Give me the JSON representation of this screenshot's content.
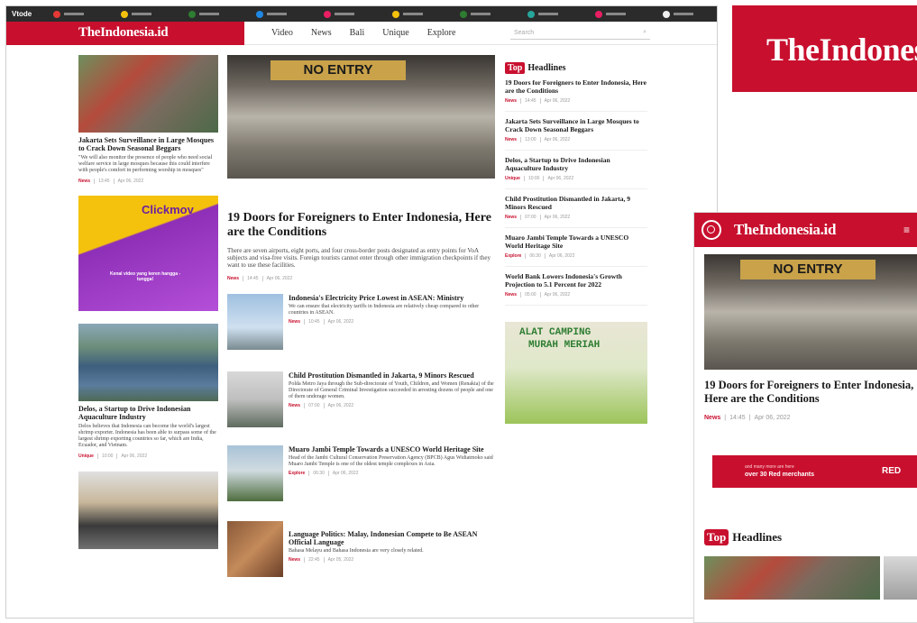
{
  "desktop": {
    "topbar": {
      "brand": "Vtode",
      "sites": [
        {
          "color": "#e53935"
        },
        {
          "color": "#f4c20d"
        },
        {
          "color": "#2e7d32"
        },
        {
          "color": "#1e88e5"
        },
        {
          "color": "#e91e63"
        },
        {
          "color": "#f4c20d"
        },
        {
          "color": "#2e7d32"
        },
        {
          "color": "#26a69a"
        },
        {
          "color": "#e91e63"
        },
        {
          "color": "#eeeeee"
        }
      ]
    },
    "logo": "TheIndonesia.id",
    "nav": [
      "Video",
      "News",
      "Bali",
      "Unique",
      "Explore"
    ],
    "search_placeholder": "Search",
    "left": [
      {
        "title": "Jakarta Sets Surveillance in Large Mosques to Crack Down Seasonal Beggars",
        "excerpt": "\"We will also monitor the presence of people who need social welfare service in large mosques because this could interfere with people's comfort in performing worship in mosques\"",
        "category": "News",
        "time": "13:45",
        "date": "Apr 06, 2022"
      },
      {
        "title": "Delos, a Startup to Drive Indonesian Aquaculture Industry",
        "excerpt": "Delos believes that Indonesia can become the world's largest shrimp exporter. Indonesia has been able to surpass some of the largest shrimp exporting countries so far, which are India, Ecuador, and Vietnam.",
        "category": "Unique",
        "time": "10:00",
        "date": "Apr 06, 2022"
      }
    ],
    "ad_clickmov": {
      "brand": "Clickmov",
      "text": "Kenal video yang keren hangga - tungga!"
    },
    "main": {
      "sign": "NO ENTRY",
      "title": "19 Doors for Foreigners to Enter Indonesia, Here are the Conditions",
      "excerpt": "There are seven airports, eight ports, and four cross-border posts designated as entry points for VoA subjects and visa-free visits. Foreign tourists cannot enter through other immigration checkpoints if they want to use these facilities.",
      "category": "News",
      "time": "14:45",
      "date": "Apr 06, 2022"
    },
    "stories": [
      {
        "title": "Indonesia's Electricity Price Lowest in ASEAN: Ministry",
        "excerpt": "We can ensure that electricity tariffs in Indonesia are relatively cheap compared to other countries in ASEAN.",
        "category": "News",
        "time": "10:45",
        "date": "Apr 06, 2022"
      },
      {
        "title": "Child Prostitution Dismantled in Jakarta, 9 Minors Rescued",
        "excerpt": "Polda Metro Jaya through the Sub-directorate of Youth, Children, and Women (Renakta) of the Directorate of General Criminal Investigation succeeded in arresting dozens of people and one of them underage women.",
        "category": "News",
        "time": "07:00",
        "date": "Apr 06, 2022"
      },
      {
        "title": "Muaro Jambi Temple Towards a UNESCO World Heritage Site",
        "excerpt": "Head of the Jambi Cultural Conservation Preservation Agency (BPCB) Agus Widiatmoko said Muaro Jambi Temple is one of the oldest temple complexes in Asia.",
        "category": "Explore",
        "time": "06:30",
        "date": "Apr 06, 2022"
      },
      {
        "title": "Language Politics: Malay, Indonesian Compete to Be ASEAN Official Language",
        "excerpt": "Bahasa Melayu and Bahasa Indonesia are very closely related.",
        "category": "News",
        "time": "22:45",
        "date": "Apr 05, 2022"
      }
    ],
    "headlines_badge": "Top",
    "headlines_label": "Headlines",
    "headlines": [
      {
        "title": "19 Doors for Foreigners to Enter Indonesia, Here are the Conditions",
        "category": "News",
        "time": "14:45",
        "date": "Apr 06, 2022"
      },
      {
        "title": "Jakarta Sets Surveillance in Large Mosques to Crack Down Seasonal Beggars",
        "category": "News",
        "time": "13:00",
        "date": "Apr 06, 2022"
      },
      {
        "title": "Delos, a Startup to Drive Indonesian Aquaculture Industry",
        "category": "Unique",
        "time": "10:00",
        "date": "Apr 06, 2022"
      },
      {
        "title": "Child Prostitution Dismantled in Jakarta, 9 Minors Rescued",
        "category": "News",
        "time": "07:00",
        "date": "Apr 06, 2022"
      },
      {
        "title": "Muaro Jambi Temple Towards a UNESCO World Heritage Site",
        "category": "Explore",
        "time": "06:30",
        "date": "Apr 06, 2022"
      },
      {
        "title": "World Bank Lowers Indonesia's Growth Projection to 5.1 Percent for 2022",
        "category": "News",
        "time": "05:00",
        "date": "Apr 06, 2022"
      }
    ],
    "ad_camping": {
      "line1": "ALAT CAMPING",
      "line2": "MURAH MERIAH"
    }
  },
  "brand_crop": "TheIndonesia.id",
  "mobile": {
    "logo": "TheIndonesia.id",
    "menu": "≡",
    "sign": "NO ENTRY",
    "title": "19 Doors for Foreigners to Enter Indonesia, Here are the Conditions",
    "category": "News",
    "time": "14:45",
    "date": "Apr 06, 2022",
    "ad": {
      "line1": "and many more are here",
      "line2": "over 30 Red merchants",
      "brand": "RED"
    },
    "headlines_badge": "Top",
    "headlines_label": "Headlines"
  }
}
